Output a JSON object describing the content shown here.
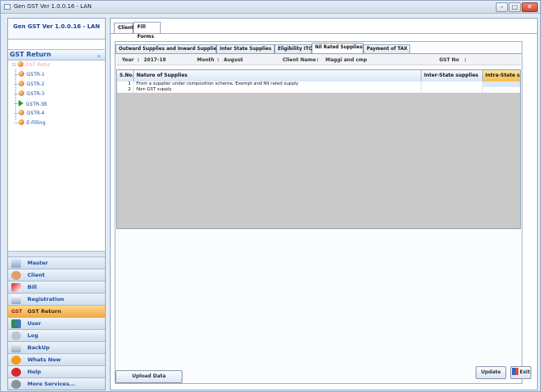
{
  "window": {
    "title": "Gen GST Ver 1.0.0.16 - LAN",
    "controls": [
      "–",
      "□",
      "✕"
    ]
  },
  "sidebar": {
    "app_name": "Gen GST Ver 1.0.0.16 - LAN",
    "section_title": "GST Return",
    "collapse_glyph": "«",
    "tree_root": "GST Retur",
    "tree_items": [
      {
        "label": "GSTR-1",
        "icon": "gear-flower-icon"
      },
      {
        "label": "GSTR-2",
        "icon": "gear-flower-icon"
      },
      {
        "label": "GSTR-3",
        "icon": "gear-flower-icon"
      },
      {
        "label": "GSTR-3B",
        "icon": "green-play-icon"
      },
      {
        "label": "GSTR-4",
        "icon": "gear-flower-icon"
      },
      {
        "label": "E-Filling",
        "icon": "gear-flower-icon"
      }
    ],
    "nav_items": [
      {
        "label": "Master",
        "icon": "master-icon"
      },
      {
        "label": "Client",
        "icon": "client-icon"
      },
      {
        "label": "Bill",
        "icon": "bill-icon"
      },
      {
        "label": "Registration",
        "icon": "registration-icon"
      },
      {
        "label": "GST Return",
        "icon": "gst-return-icon",
        "active": true
      },
      {
        "label": "User",
        "icon": "user-icon"
      },
      {
        "label": "Log",
        "icon": "log-icon"
      },
      {
        "label": "BackUp",
        "icon": "backup-icon"
      },
      {
        "label": "Whats New",
        "icon": "new-icon"
      },
      {
        "label": "Help",
        "icon": "help-icon"
      },
      {
        "label": "More Services...",
        "icon": "services-icon"
      }
    ]
  },
  "main": {
    "top_tabs": [
      "Client",
      "Fill Forms"
    ],
    "active_top_tab": "Fill Forms",
    "sub_tabs": [
      "Outward Supplies and Inward Supplies",
      "Inter State Supplies",
      "Eligibility ITC",
      "Nil Rated Supplies",
      "Payment of TAX"
    ],
    "active_sub_tab": "Nil Rated Supplies",
    "info": {
      "year_label": "Year",
      "year_value": "2017-18",
      "month_label": "Month",
      "month_value": "August",
      "client_label": "Client Name",
      "client_value": "Maggi and cmp",
      "gst_label": "GST No",
      "gst_value": ""
    },
    "table": {
      "columns": [
        "S.No.",
        "Nature of Supplies",
        "Inter-State supplies",
        "Intra-State su"
      ],
      "rows": [
        {
          "sno": "1",
          "nature": "From a supplier under composition scheme, Exempt and Nil rated supply",
          "inter": "",
          "intra": ""
        },
        {
          "sno": "2",
          "nature": "Non GST supply",
          "inter": "",
          "intra": ""
        }
      ]
    },
    "buttons": {
      "upload": "Upload Data",
      "update": "Update",
      "exit": "Exit"
    }
  },
  "colors": {
    "active_nav": "#f4a844",
    "selected_column": "#f4bb4b",
    "accent_blue": "#1d4d9d"
  }
}
